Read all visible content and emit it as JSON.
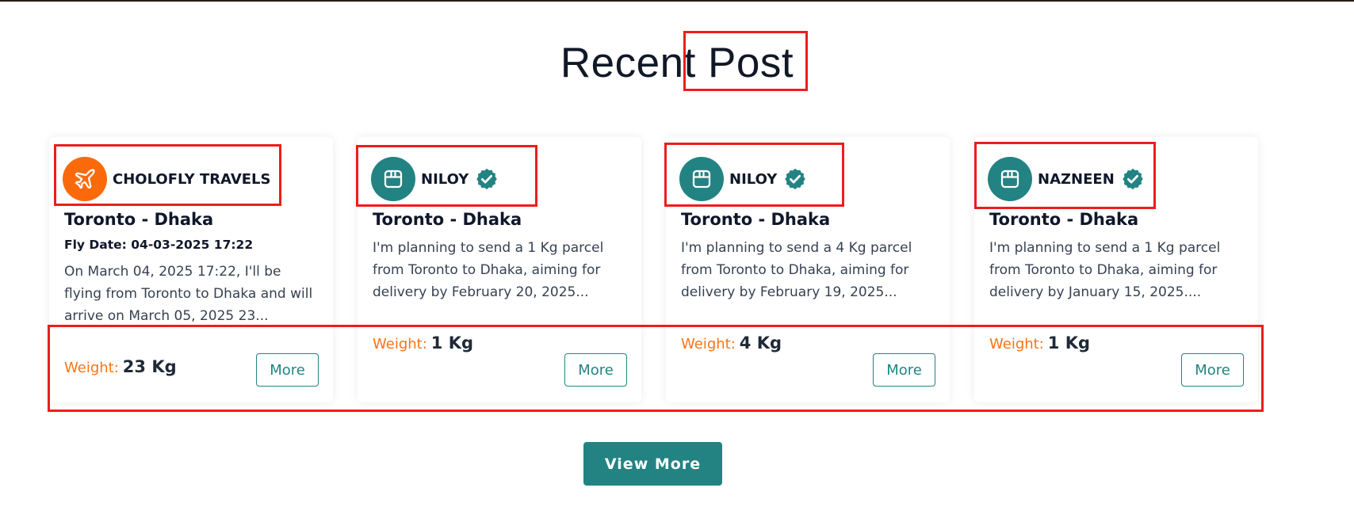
{
  "section": {
    "title": "Recent Post",
    "view_more_label": "View More"
  },
  "colors": {
    "accent": "#238383",
    "weight_label": "#f97316",
    "traveler_avatar": "#fb6a0a",
    "annotation": "#ef1c1c"
  },
  "cards": [
    {
      "author": "CHOLOFLY TRAVELS",
      "avatar_icon": "airplane-icon",
      "verified": false,
      "route": "Toronto - Dhaka",
      "fly_date": "Fly Date: 04-03-2025 17:22",
      "description": "On March 04, 2025 17:22, I'll be flying from Toronto to Dhaka and will arrive on March 05, 2025 23...",
      "weight_label": "Weight:",
      "weight_value": "23 Kg",
      "more_label": "More"
    },
    {
      "author": "NILOY",
      "avatar_icon": "package-icon",
      "verified": true,
      "route": "Toronto - Dhaka",
      "description": "I'm planning to send a 1 Kg parcel from Toronto to Dhaka, aiming for delivery by February 20, 2025...",
      "weight_label": "Weight:",
      "weight_value": "1 Kg",
      "more_label": "More"
    },
    {
      "author": "NILOY",
      "avatar_icon": "package-icon",
      "verified": true,
      "route": "Toronto - Dhaka",
      "description": "I'm planning to send a 4 Kg parcel from Toronto to Dhaka, aiming for delivery by February 19, 2025...",
      "weight_label": "Weight:",
      "weight_value": "4 Kg",
      "more_label": "More"
    },
    {
      "author": "NAZNEEN",
      "avatar_icon": "package-icon",
      "verified": true,
      "route": "Toronto - Dhaka",
      "description": "I'm planning to send a 1 Kg parcel from Toronto to Dhaka, aiming for delivery by January 15, 2025....",
      "weight_label": "Weight:",
      "weight_value": "1 Kg",
      "more_label": "More"
    }
  ]
}
